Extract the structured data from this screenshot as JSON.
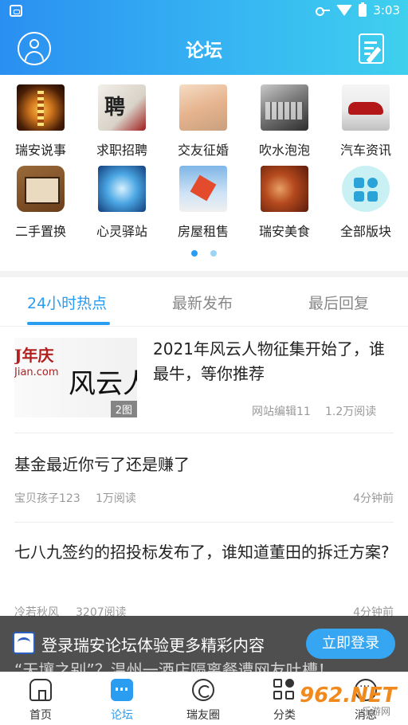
{
  "status_bar": {
    "time": "3:03"
  },
  "header": {
    "title": "论坛"
  },
  "categories": [
    {
      "label": "瑞安说事",
      "icon": "pagoda-photo"
    },
    {
      "label": "求职招聘",
      "icon": "job-photo"
    },
    {
      "label": "交友征婚",
      "icon": "hands-photo"
    },
    {
      "label": "吹水泡泡",
      "icon": "keyboard-photo"
    },
    {
      "label": "汽车资讯",
      "icon": "car-photo"
    },
    {
      "label": "二手置换",
      "icon": "box-photo"
    },
    {
      "label": "心灵驿站",
      "icon": "heart-photo"
    },
    {
      "label": "房屋租售",
      "icon": "house-photo"
    },
    {
      "label": "瑞安美食",
      "icon": "food-photo"
    },
    {
      "label": "全部版块",
      "icon": "grid-icon"
    }
  ],
  "tabs": [
    {
      "label": "24小时热点",
      "active": true
    },
    {
      "label": "最新发布",
      "active": false
    },
    {
      "label": "最后回复",
      "active": false
    }
  ],
  "posts": [
    {
      "title": "2021年风云人物征集开始了，谁最牛，等你推荐",
      "author": "网站编辑11",
      "reads": "1.2万阅读",
      "image_text": {
        "line1": "J年庆",
        "line2": "Jian.com",
        "line3": "风云人"
      },
      "image_badge": "2图"
    },
    {
      "title": "基金最近你亏了还是赚了",
      "author": "宝贝孩子123",
      "reads": "1万阅读",
      "time": "4分钟前"
    },
    {
      "title": "七八九签约的招投标发布了，谁知道董田的拆迁方案?",
      "author": "冷若秋风",
      "reads": "3207阅读",
      "time": "4分钟前"
    },
    {
      "title": "“天壤之别”？温州一酒店隔离餐遭网友吐槽！"
    }
  ],
  "login_banner": {
    "logo_text": "瑞安论坛",
    "message": "登录瑞安论坛体验更多精彩内容",
    "button": "立即登录"
  },
  "bottom_nav": [
    {
      "label": "首页",
      "icon": "home-icon",
      "active": false
    },
    {
      "label": "论坛",
      "icon": "forum-icon",
      "active": true
    },
    {
      "label": "瑞友圈",
      "icon": "circle-icon",
      "active": false
    },
    {
      "label": "分类",
      "icon": "category-icon",
      "active": false
    },
    {
      "label": "消息",
      "icon": "message-icon",
      "active": false
    }
  ],
  "watermark": {
    "brand": "962.NET",
    "sub": "乐游网"
  },
  "colors": {
    "accent": "#2a9df1",
    "header_start": "#2a8ff1",
    "header_end": "#3fd0ee"
  }
}
